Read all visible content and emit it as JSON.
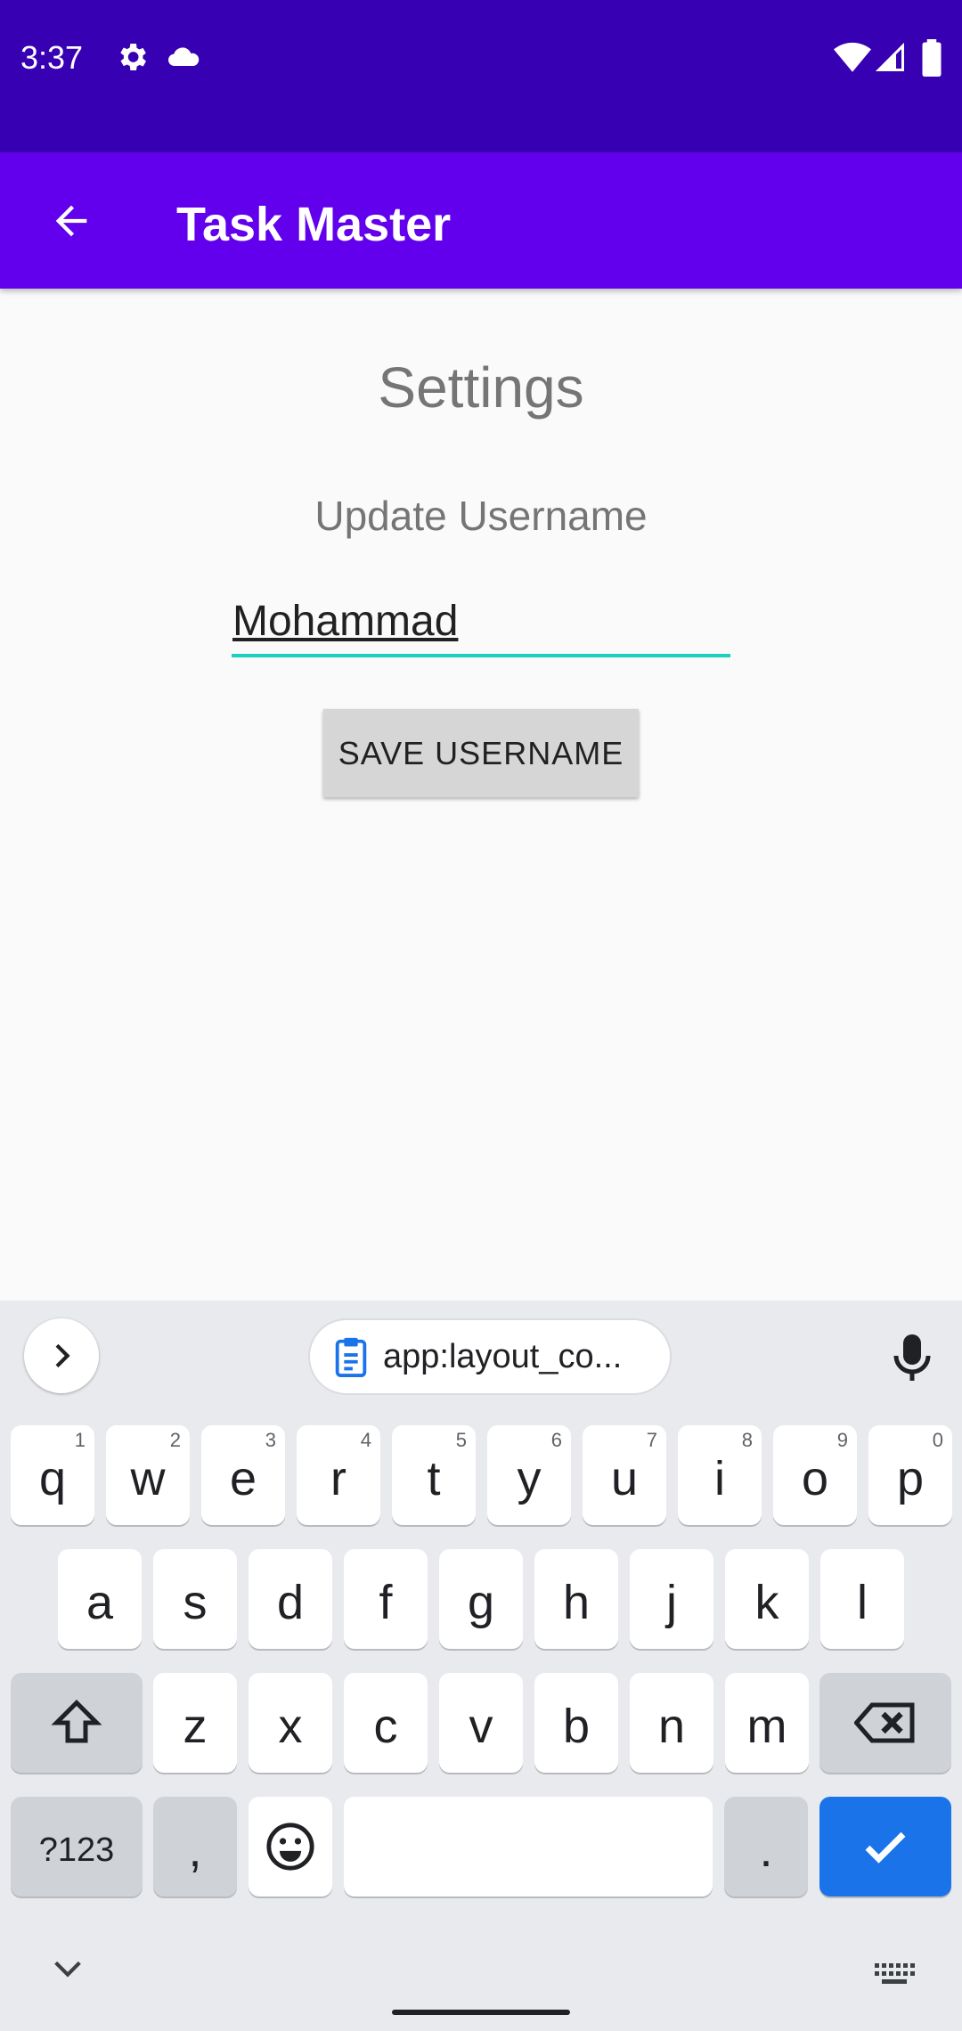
{
  "status_bar": {
    "time": "3:37"
  },
  "app_bar": {
    "title": "Task Master"
  },
  "content": {
    "title": "Settings",
    "update_label": "Update Username",
    "username_value": "Mohammad",
    "save_label": "SAVE USERNAME"
  },
  "keyboard": {
    "clipboard_chip": "app:layout_co...",
    "row1": [
      {
        "k": "q",
        "n": "1"
      },
      {
        "k": "w",
        "n": "2"
      },
      {
        "k": "e",
        "n": "3"
      },
      {
        "k": "r",
        "n": "4"
      },
      {
        "k": "t",
        "n": "5"
      },
      {
        "k": "y",
        "n": "6"
      },
      {
        "k": "u",
        "n": "7"
      },
      {
        "k": "i",
        "n": "8"
      },
      {
        "k": "o",
        "n": "9"
      },
      {
        "k": "p",
        "n": "0"
      }
    ],
    "row2": [
      "a",
      "s",
      "d",
      "f",
      "g",
      "h",
      "j",
      "k",
      "l"
    ],
    "row3": [
      "z",
      "x",
      "c",
      "v",
      "b",
      "n",
      "m"
    ],
    "symbols_key": "?123",
    "comma_key": ",",
    "period_key": "."
  },
  "colors": {
    "status_bar": "#3700b3",
    "app_bar": "#6200ee",
    "field_underline": "#1dd1c1",
    "enter_key": "#1a73e8"
  }
}
